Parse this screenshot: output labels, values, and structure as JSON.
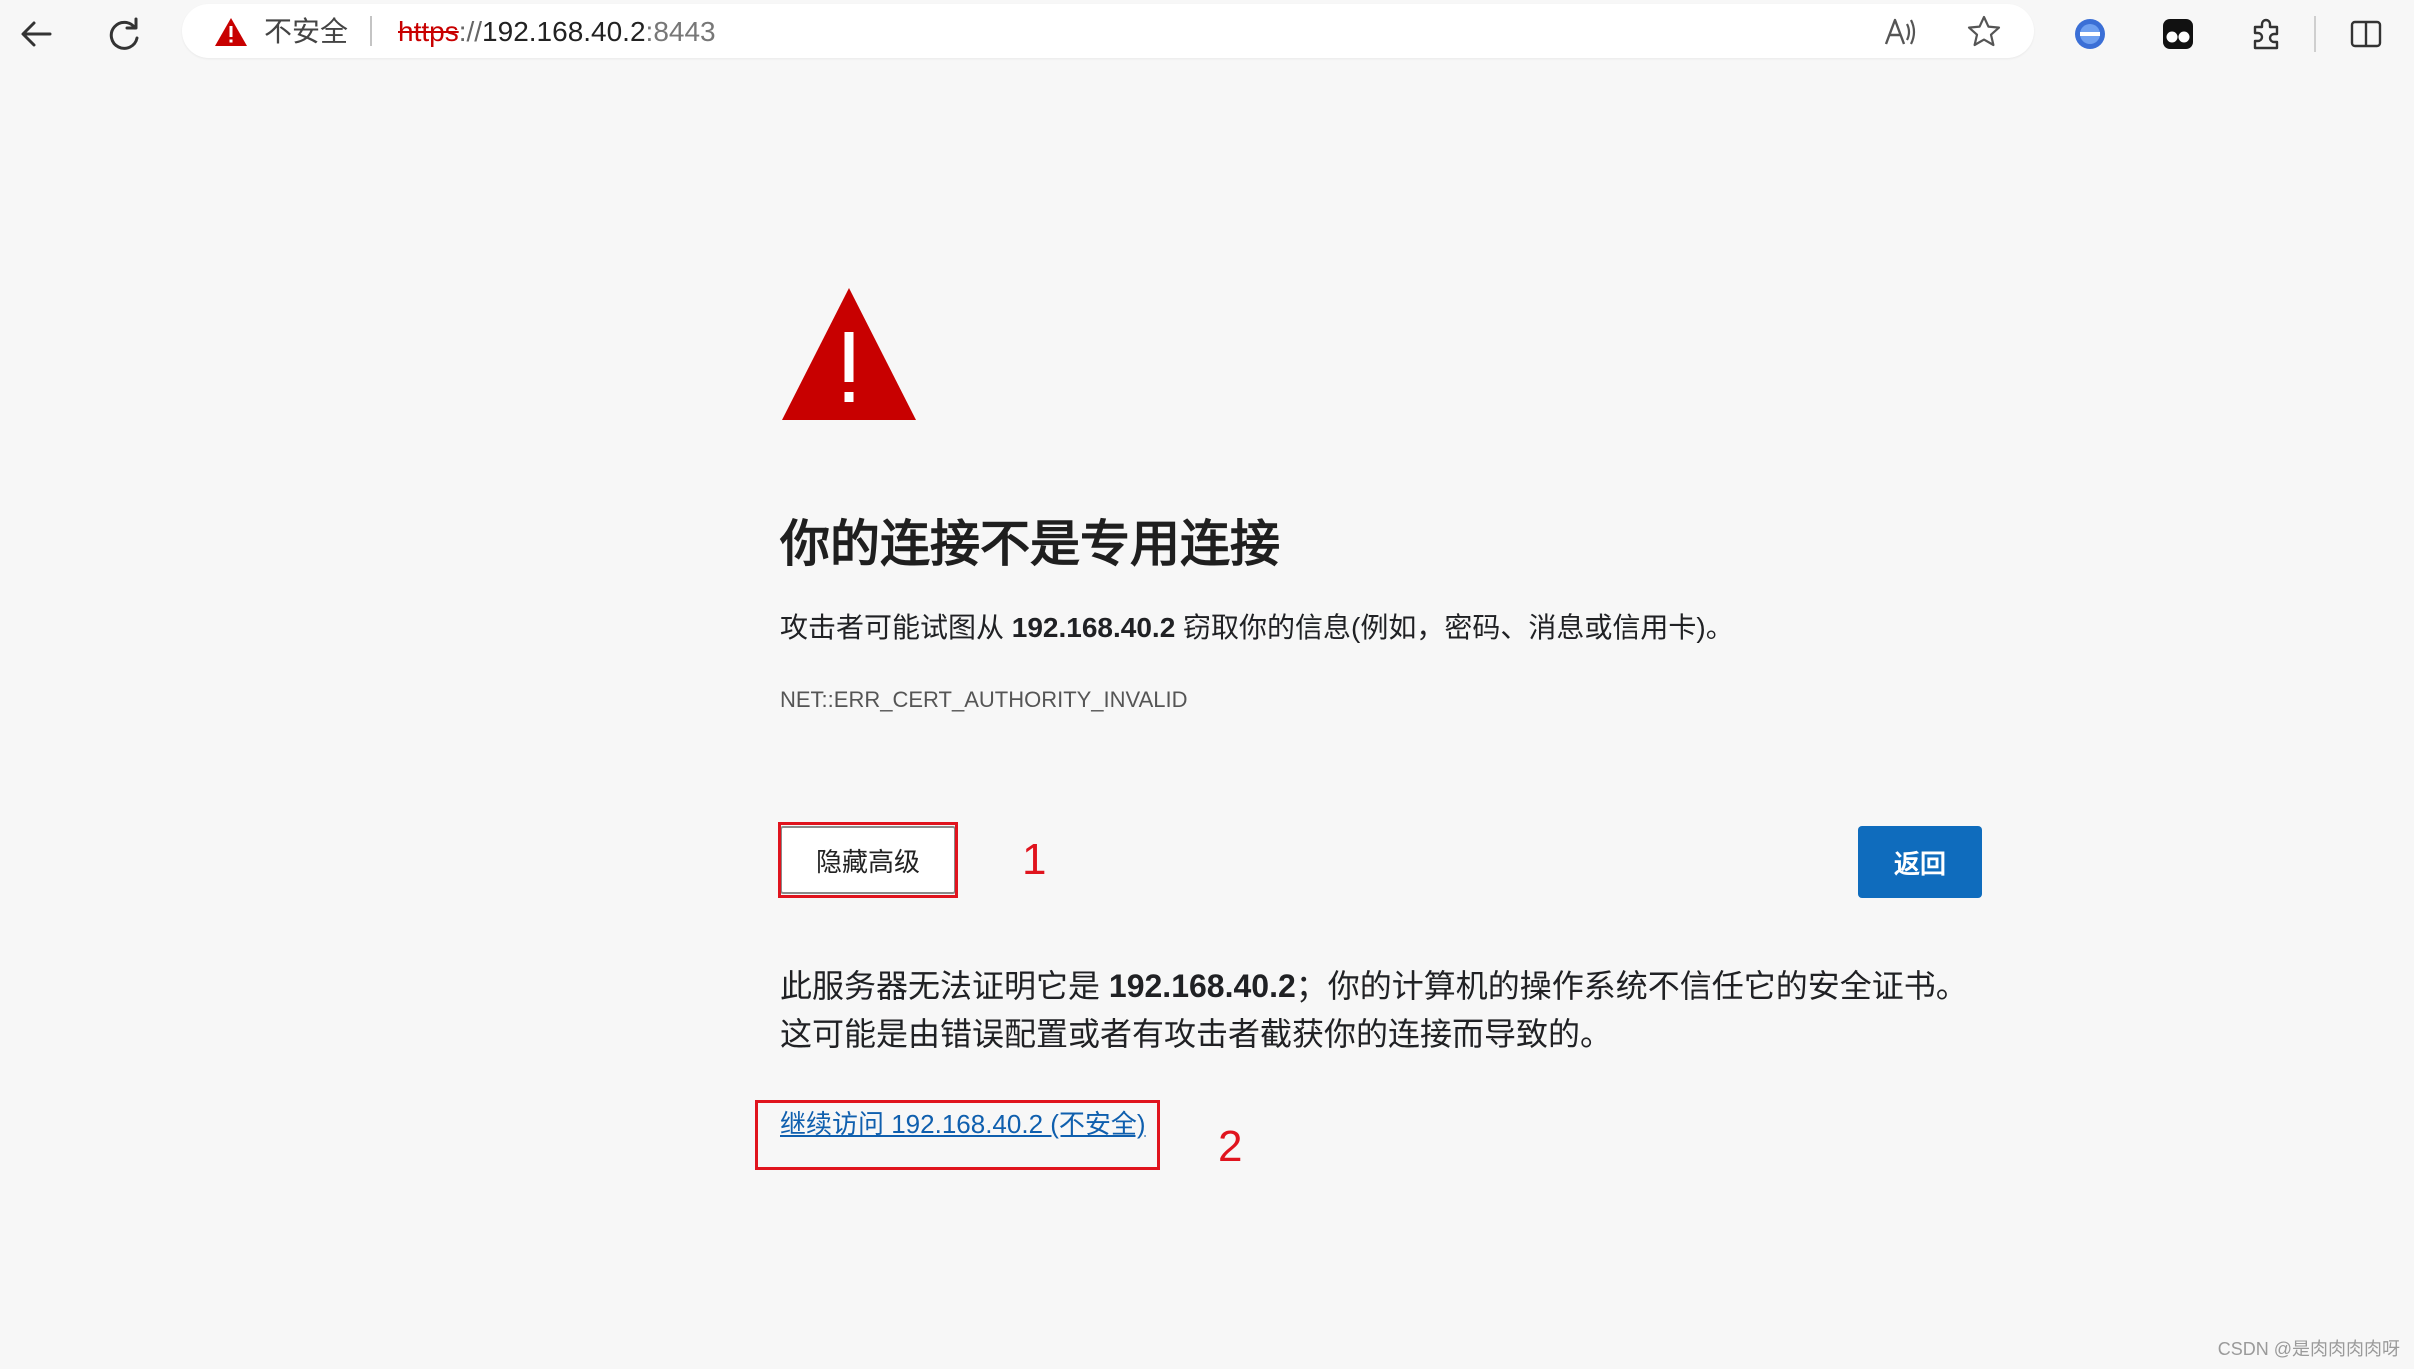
{
  "toolbar": {
    "insecure_label": "不安全",
    "url": {
      "scheme": "https",
      "separator": "://",
      "host": "192.168.40.2",
      "port": ":8443"
    },
    "icons": [
      "back-icon",
      "reload-icon",
      "warning-icon",
      "read-aloud-icon",
      "favorite-star-icon",
      "extension-avatar-icon",
      "tampermonkey-icon",
      "puzzle-extensions-icon",
      "split-screen-icon"
    ]
  },
  "page": {
    "title": "你的连接不是专用连接",
    "desc_before": "攻击者可能试图从 ",
    "desc_host": "192.168.40.2",
    "desc_after": " 窃取你的信息(例如，密码、消息或信用卡)。",
    "error_code": "NET::ERR_CERT_AUTHORITY_INVALID",
    "advanced_button": "隐藏高级",
    "back_button": "返回",
    "detail_before": "此服务器无法证明它是 ",
    "detail_host": "192.168.40.2",
    "detail_after": "；你的计算机的操作系统不信任它的安全证书。这可能是由错误配置或者有攻击者截获你的连接而导致的。",
    "proceed_link": "继续访问 192.168.40.2 (不安全)"
  },
  "annotations": {
    "step1": "1",
    "step2": "2",
    "color": "#e0141e"
  },
  "watermark": "CSDN @是肉肉肉肉呀",
  "colors": {
    "warning_red": "#c80000",
    "primary_blue": "#0f6cbd",
    "link_blue": "#0f5fae",
    "page_bg": "#f7f7f7"
  }
}
